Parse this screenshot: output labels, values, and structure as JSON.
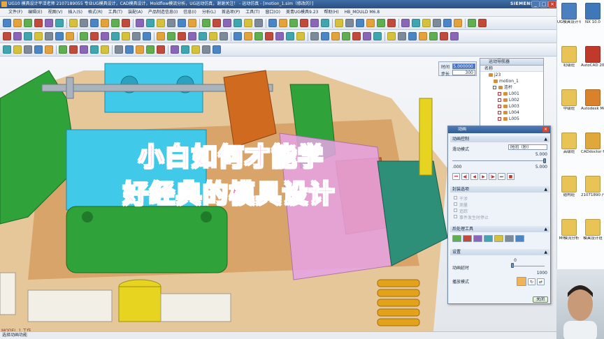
{
  "window": {
    "title": "UG10 模具设计平活老师 2107189055 专业UG模具设计，CAD模具设计，Moldflow模流分析，UG运动仿真，谢谢关注！ - 运动仿真 - [motion_1.sim（修改的）]",
    "brand": "SIEMENS",
    "controls": [
      "_",
      "□",
      "×"
    ]
  },
  "menubar": [
    "文件(F)",
    "编辑(E)",
    "视图(V)",
    "插入(S)",
    "格式(R)",
    "工具(T)",
    "装配(A)",
    "产品制造信息(I)",
    "信息(I)",
    "分析(L)",
    "首选项(P)",
    "工具(T)",
    "窗口(O)",
    "美青UG模具9.23",
    "帮助(H)",
    "HB_MOULD M6.8"
  ],
  "time_box": {
    "time_label": "时间",
    "time_value": "5.000000",
    "step_label": "步长",
    "step_value": "300"
  },
  "navigator": {
    "title": "运动导航器",
    "column": "名称",
    "tree": [
      {
        "label": "j23",
        "indent": 0,
        "checked": false
      },
      {
        "label": "motion_1",
        "indent": 1,
        "checked": false
      },
      {
        "label": "连杆",
        "indent": 2,
        "checked": true
      },
      {
        "label": "L001",
        "indent": 3,
        "checked": true
      },
      {
        "label": "L002",
        "indent": 3,
        "checked": true
      },
      {
        "label": "L003",
        "indent": 3,
        "checked": true
      },
      {
        "label": "L004",
        "indent": 3,
        "checked": true
      },
      {
        "label": "L005",
        "indent": 3,
        "checked": true
      }
    ]
  },
  "animation_dialog": {
    "title": "动画",
    "close": "×",
    "section_control": "动画控制",
    "slide_mode_label": "滑动模式",
    "slide_mode_value": "时间（秒）",
    "slider_max": "5.000",
    "slider_min": ".000",
    "slider_current": "5.000",
    "section_seal": "封装选项",
    "seal_options": [
      "干涉",
      "测量",
      "追踪",
      "事件发生时停止"
    ],
    "section_post": "后处理工具",
    "section_settings": "设置",
    "delay_label": "动画延时",
    "delay_value": "0",
    "delay_max": "1000",
    "play_mode_label": "播放模式",
    "ok": "关闭"
  },
  "caption": {
    "line1": "小白如何才能学",
    "line2": "好经典的模具设计",
    "color": "#ff5cc0"
  },
  "status": {
    "model_tag": "MODEL_1 工作",
    "text": "选择动画功能"
  },
  "desktop_icons": [
    {
      "label": "UG模具设计平活",
      "color": "#4a7fc0"
    },
    {
      "label": "NX 10.0",
      "color": "#3f77b8"
    },
    {
      "label": "初级班",
      "color": "#e8c456"
    },
    {
      "label": "AutoCAD 2008 - 简",
      "color": "#c0392b"
    },
    {
      "label": "中级班",
      "color": "#e8c456"
    },
    {
      "label": "Autodesk Moldflo",
      "color": "#d9822b"
    },
    {
      "label": "高级班",
      "color": "#e8c456"
    },
    {
      "label": "CADdoctor for Autod",
      "color": "#e0a83a"
    },
    {
      "label": "结构班",
      "color": "#e8c456"
    },
    {
      "label": "21071890 产品开模班",
      "color": "#e8c456"
    },
    {
      "label": "Mf模流分析",
      "color": "#e8c456"
    },
    {
      "label": "模具设计班",
      "color": "#e8c456"
    }
  ]
}
